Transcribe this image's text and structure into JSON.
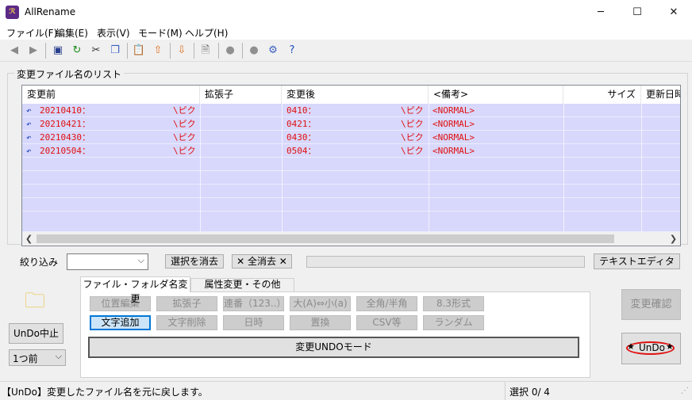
{
  "window": {
    "title": "AllRename",
    "app_icon_text": "ℛ",
    "minimize": "─",
    "maximize": "☐",
    "close": "✕"
  },
  "menu": [
    "ファイル(F)",
    "編集(E)",
    "表示(V)",
    "モード(M)",
    "ヘルプ(H)"
  ],
  "list_group": {
    "label": "変更ファイル名のリスト"
  },
  "columns": [
    "変更前",
    "拡張子",
    "変更後",
    "<備考>",
    "サイズ",
    "更新日時"
  ],
  "rows": [
    {
      "before": "20210410：",
      "before_tail": "\\ピク",
      "after": "0410：",
      "after_tail": "\\ピク",
      "note": "<NORMAL>"
    },
    {
      "before": "20210421：",
      "before_tail": "\\ピク",
      "after": "0421：",
      "after_tail": "\\ピク",
      "note": "<NORMAL>"
    },
    {
      "before": "20210430：",
      "before_tail": "\\ピク",
      "after": "0430：",
      "after_tail": "\\ピク",
      "note": "<NORMAL>"
    },
    {
      "before": "20210504：",
      "before_tail": "\\ピク",
      "after": "0504：",
      "after_tail": "\\ピク",
      "note": "<NORMAL>"
    }
  ],
  "filter": {
    "label": "絞り込み",
    "value": "",
    "clear_selection_label": "選択を消去",
    "clear_all_label": "✕ 全消去 ✕",
    "text_editor_label": "テキストエディタ"
  },
  "tabs": [
    "ファイル・フォルダ名変更",
    "属性変更・その他"
  ],
  "ops_row1": [
    "位置編集",
    "拡張子",
    "連番（123..）",
    "大(A)⇔小(a)",
    "全角/半角",
    "8.3形式"
  ],
  "ops_row2": [
    "文字追加",
    "文字削除",
    "日時",
    "置換",
    "CSV等",
    "ランダム"
  ],
  "undo_mode_label": "変更UNDOモード",
  "left_panel": {
    "undo_stop_label": "UnDo中止",
    "step_select": "1つ前"
  },
  "right_panel": {
    "confirm_label": "変更確認",
    "undo_label": "UnDo"
  },
  "status": {
    "message": "【UnDo】変更したファイル名を元に戻します。",
    "selection": "選択 0/ 4"
  },
  "colors": {
    "row_bg": "#d8d8fc",
    "row_text": "#e01010",
    "undo_ring": "#e01010"
  }
}
